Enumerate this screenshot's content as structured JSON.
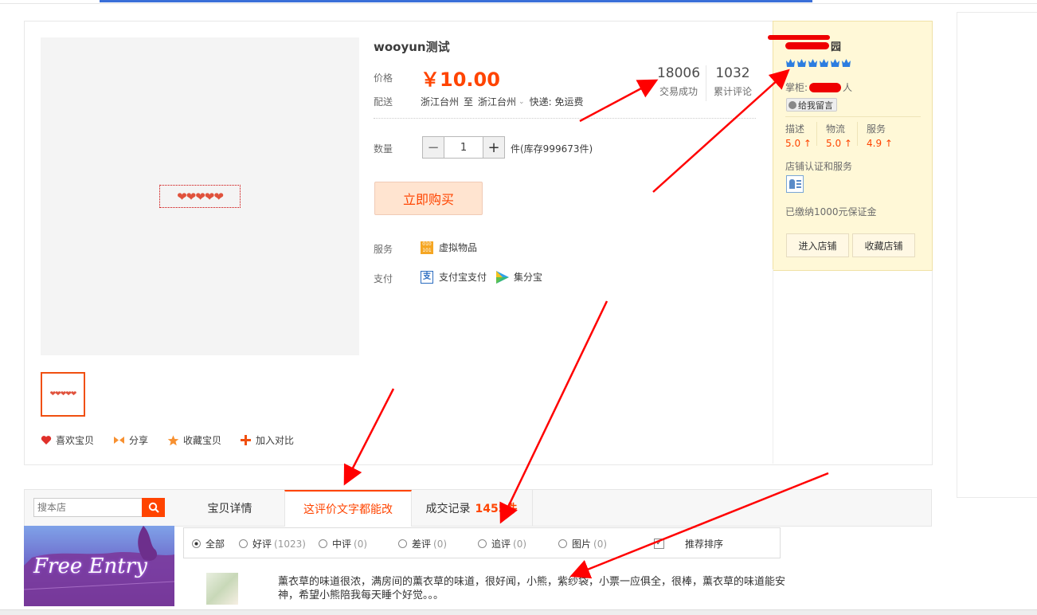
{
  "product": {
    "title": "wooyun测试",
    "price_label": "价格",
    "price": "￥10.00",
    "delivery_label": "配送",
    "delivery_from": "浙江台州",
    "delivery_to_word": "至",
    "delivery_to": "浙江台州",
    "delivery_method": "快递: 免运费",
    "deals_count": "18006",
    "deals_label": "交易成功",
    "reviews_count": "1032",
    "reviews_label": "累计评论",
    "qty_label": "数量",
    "qty_value": "1",
    "stock_text": "件(库存999673件)",
    "buy_label": "立即购买",
    "service_label": "服务",
    "service_item": "虚拟物品",
    "pay_label": "支付",
    "pay_alipay": "支付宝支付",
    "pay_jifen": "集分宝",
    "image_hearts": "❤❤❤❤❤",
    "thumb_hearts": "❤❤❤❤❤"
  },
  "actions": {
    "like": "喜欢宝贝",
    "share": "分享",
    "favorite": "收藏宝贝",
    "compare": "加入对比"
  },
  "shop": {
    "name_suffix": "园",
    "keeper_label": "掌柜:",
    "keeper_suffix": "人",
    "message_button": "给我留言",
    "desc_label": "描述",
    "desc_score": "5.0",
    "logistics_label": "物流",
    "logistics_score": "5.0",
    "service_label": "服务",
    "service_score": "4.9",
    "cert_label": "店铺认证和服务",
    "deposit": "已缴纳1000元保证金",
    "enter_button": "进入店铺",
    "favorite_button": "收藏店铺"
  },
  "search": {
    "placeholder": "搜本店"
  },
  "banner": {
    "text": "Free Entry"
  },
  "tabs": {
    "details": "宝贝详情",
    "reviews": "这评价文字都能改",
    "records": "成交记录",
    "records_count": "1455件"
  },
  "filters": {
    "all": "全部",
    "good": "好评",
    "good_count": "(1023)",
    "neutral": "中评",
    "neutral_count": "(0)",
    "bad": "差评",
    "bad_count": "(0)",
    "followup": "追评",
    "followup_count": "(0)",
    "pictures": "图片",
    "pictures_count": "(0)",
    "recommend_sort": "推荐排序"
  },
  "review": {
    "text": "薰衣草的味道很浓，满房间的薰衣草的味道，很好闻，小熊，紫纱袋，小票一应俱全，很棒，薰衣草的味道能安神，希望小熊陪我每天睡个好觉。。。"
  },
  "colors": {
    "accent": "#ff4400",
    "arrow": "#ff0000",
    "shop_bg": "#fff8d7"
  }
}
